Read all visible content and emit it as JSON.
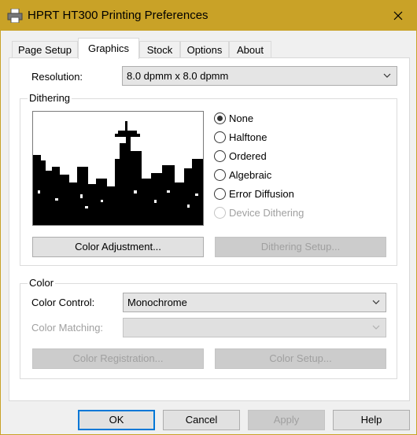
{
  "window": {
    "title": "HPRT HT300 Printing Preferences",
    "accent": "#c9a227"
  },
  "tabs": [
    {
      "label": "Page Setup"
    },
    {
      "label": "Graphics"
    },
    {
      "label": "Stock"
    },
    {
      "label": "Options"
    },
    {
      "label": "About"
    }
  ],
  "active_tab": "Graphics",
  "resolution": {
    "label": "Resolution:",
    "value": "8.0 dpmm x 8.0 dpmm"
  },
  "dithering": {
    "title": "Dithering",
    "options": [
      {
        "label": "None",
        "selected": true,
        "enabled": true
      },
      {
        "label": "Halftone",
        "selected": false,
        "enabled": true
      },
      {
        "label": "Ordered",
        "selected": false,
        "enabled": true
      },
      {
        "label": "Algebraic",
        "selected": false,
        "enabled": true
      },
      {
        "label": "Error Diffusion",
        "selected": false,
        "enabled": true
      },
      {
        "label": "Device Dithering",
        "selected": false,
        "enabled": false
      }
    ],
    "color_adjustment_button": "Color Adjustment...",
    "dithering_setup_button": "Dithering Setup..."
  },
  "color": {
    "title": "Color",
    "control_label": "Color Control:",
    "control_value": "Monochrome",
    "matching_label": "Color Matching:",
    "matching_value": "",
    "registration_button": "Color Registration...",
    "setup_button": "Color Setup..."
  },
  "footer": {
    "ok": "OK",
    "cancel": "Cancel",
    "apply": "Apply",
    "help": "Help"
  }
}
